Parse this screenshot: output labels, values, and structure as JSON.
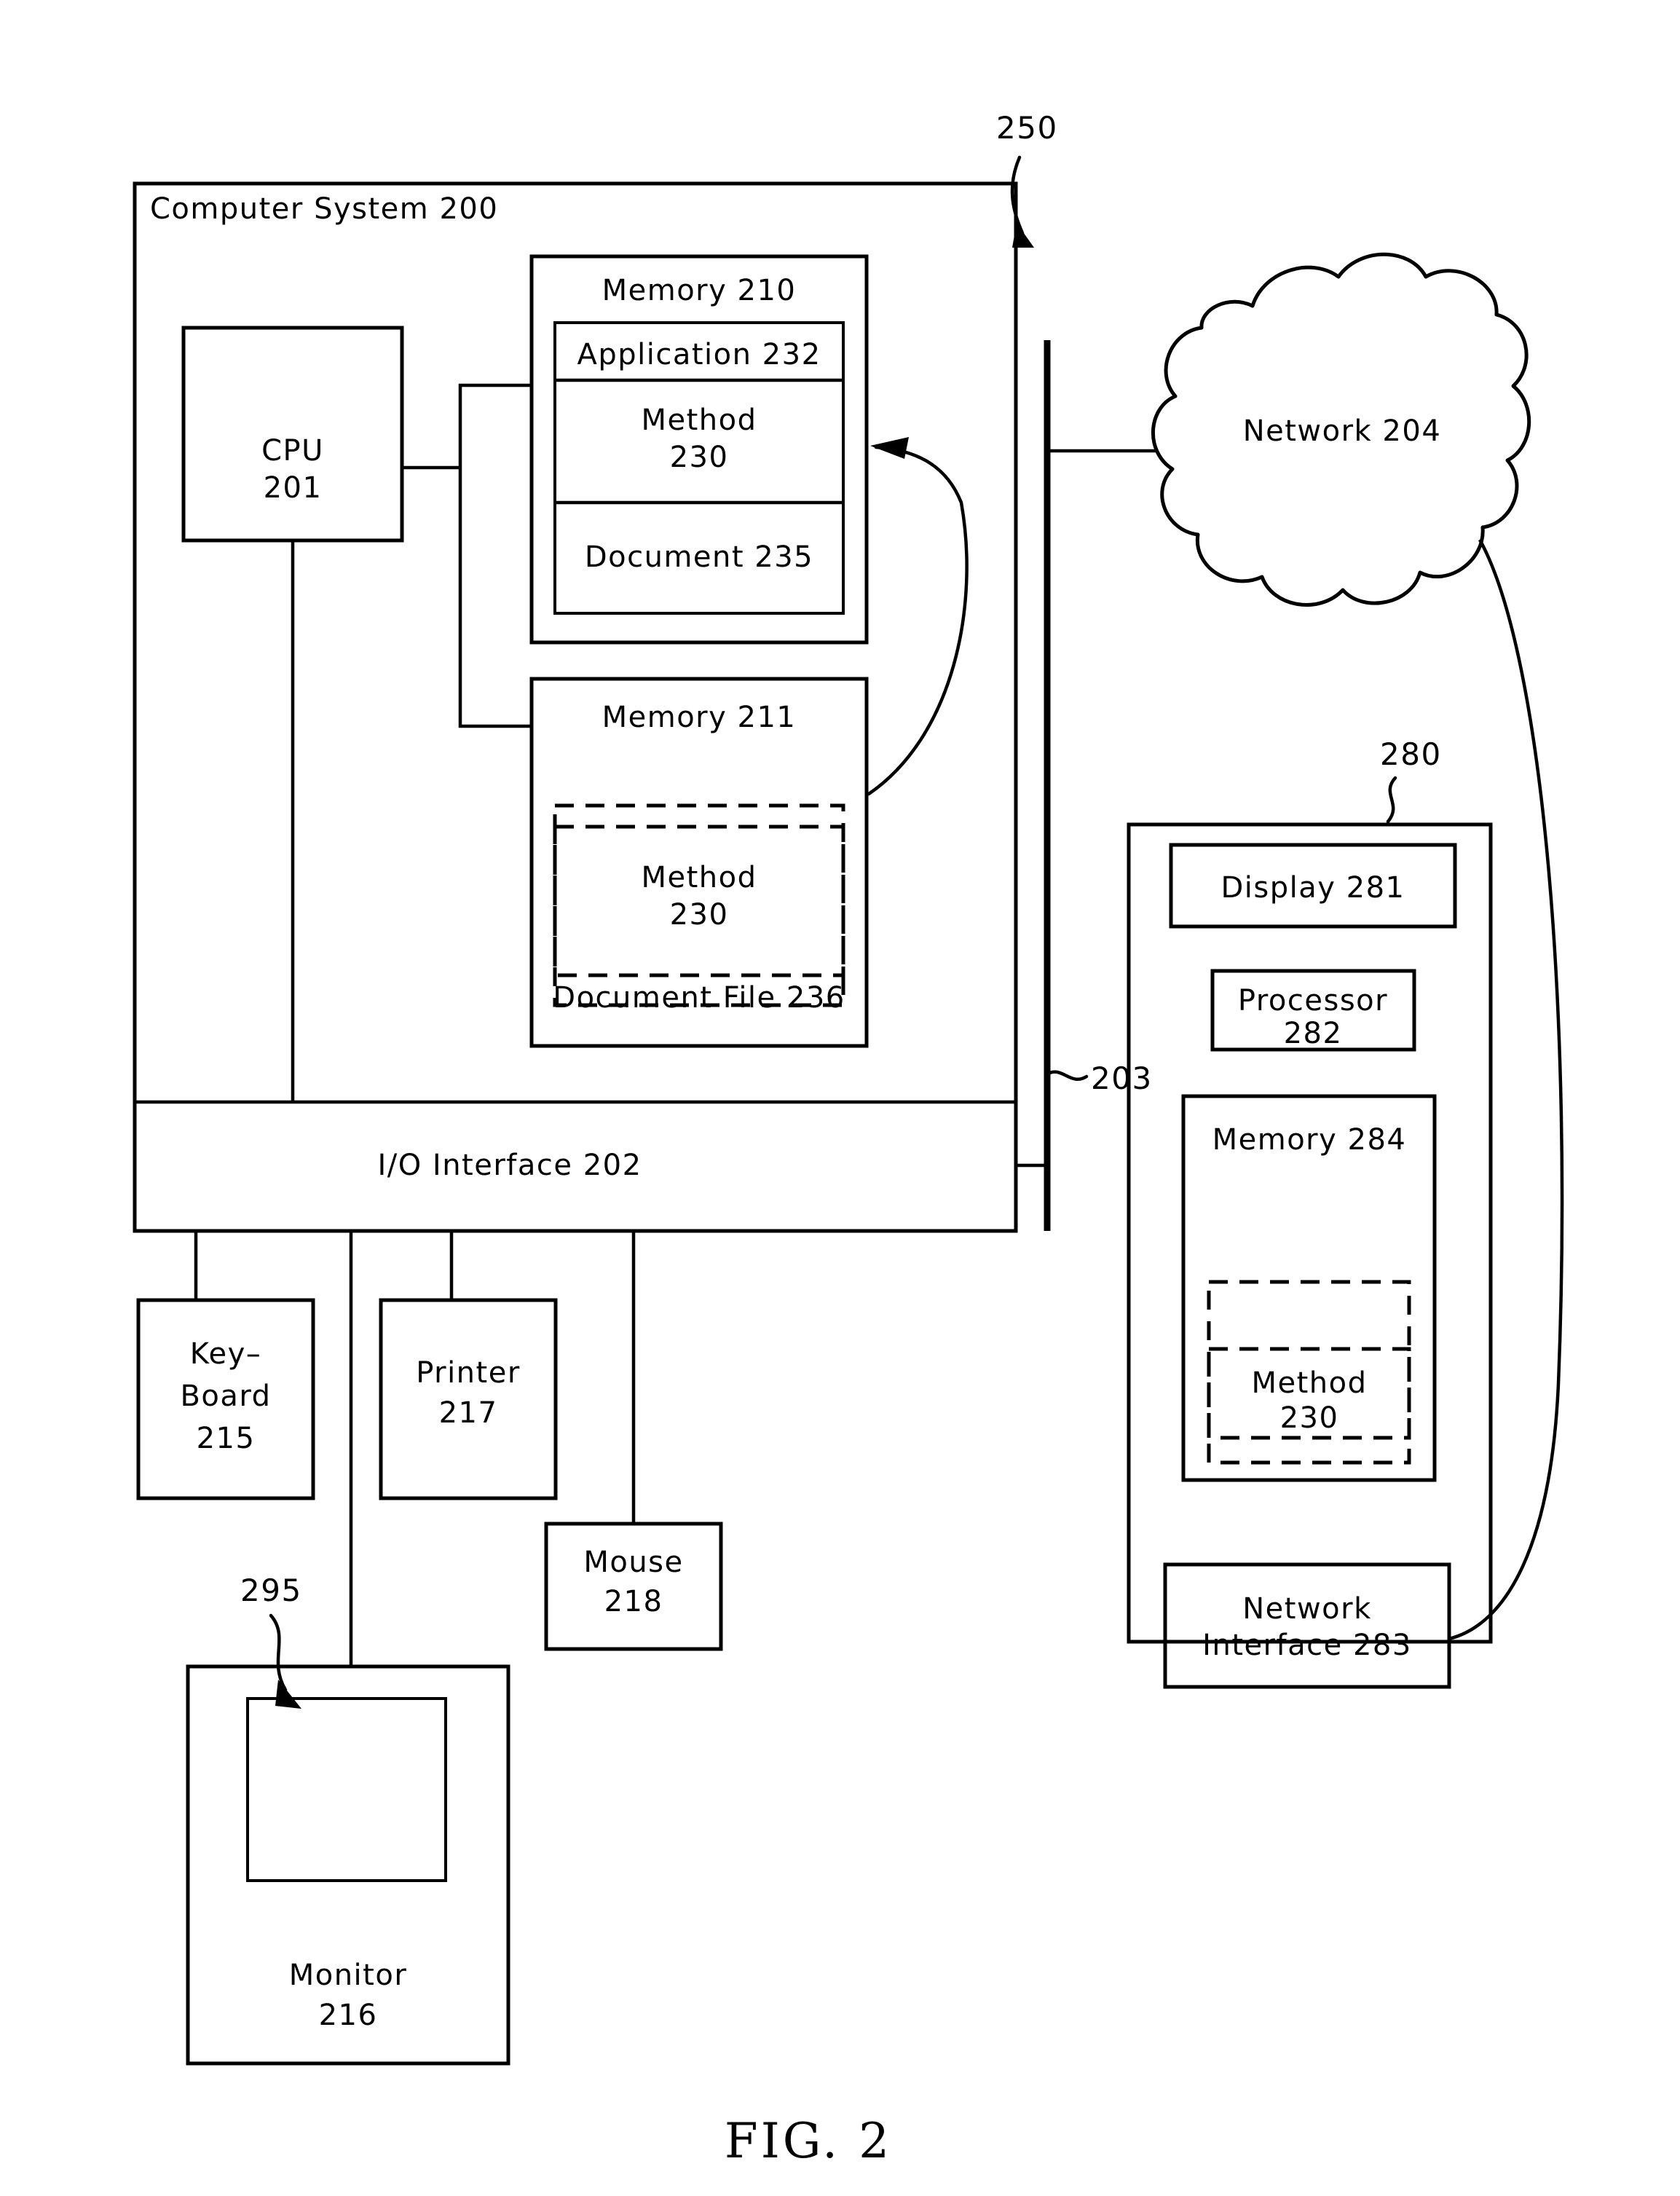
{
  "figure": {
    "caption": "FIG. 2"
  },
  "system": {
    "title": "Computer System 200",
    "cpu": {
      "line1": "CPU",
      "line2": "201"
    },
    "memory210": {
      "title": "Memory 210",
      "rows": [
        {
          "label": "Application 232"
        },
        {
          "label_line1": "Method",
          "label_line2": "230"
        },
        {
          "label": "Document 235"
        }
      ]
    },
    "memory211": {
      "title": "Memory 211",
      "method_line1": "Method",
      "method_line2": "230",
      "document_file": "Document File 236"
    },
    "io_interface": "I/O Interface 202"
  },
  "peripherals": [
    {
      "name": "keyboard",
      "line1": "Key–",
      "line2": "Board",
      "line3": "215"
    },
    {
      "name": "printer",
      "line1": "Printer",
      "line2": "217"
    },
    {
      "name": "mouse",
      "line1": "Mouse",
      "line2": "218"
    },
    {
      "name": "monitor",
      "line1": "Monitor",
      "line2": "216"
    }
  ],
  "callouts": {
    "ref250": "250",
    "ref203": "203",
    "ref280": "280",
    "ref295": "295"
  },
  "network": {
    "label": "Network 204"
  },
  "device280": {
    "display": "Display 281",
    "processor_line1": "Processor",
    "processor_line2": "282",
    "memory284": {
      "title": "Memory 284",
      "method_line1": "Method",
      "method_line2": "230"
    },
    "network_interface_line1": "Network",
    "network_interface_line2": "Interface 283"
  },
  "colors": {
    "ink": "#000000",
    "paper": "#ffffff"
  }
}
